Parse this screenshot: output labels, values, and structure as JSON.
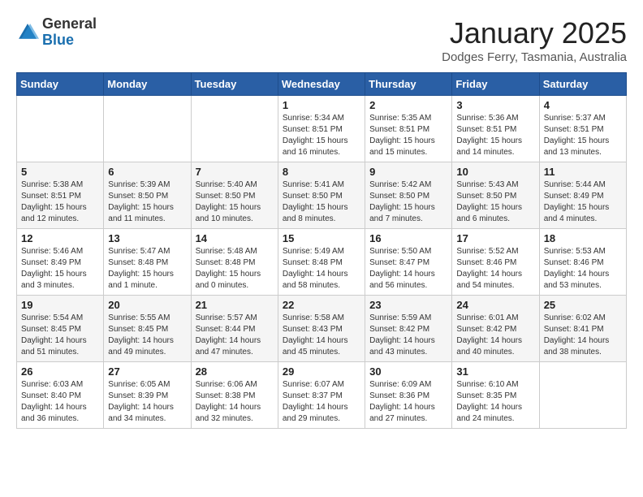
{
  "header": {
    "logo_general": "General",
    "logo_blue": "Blue",
    "month_title": "January 2025",
    "location": "Dodges Ferry, Tasmania, Australia"
  },
  "days_of_week": [
    "Sunday",
    "Monday",
    "Tuesday",
    "Wednesday",
    "Thursday",
    "Friday",
    "Saturday"
  ],
  "weeks": [
    [
      {
        "day": "",
        "info": ""
      },
      {
        "day": "",
        "info": ""
      },
      {
        "day": "",
        "info": ""
      },
      {
        "day": "1",
        "info": "Sunrise: 5:34 AM\nSunset: 8:51 PM\nDaylight: 15 hours\nand 16 minutes."
      },
      {
        "day": "2",
        "info": "Sunrise: 5:35 AM\nSunset: 8:51 PM\nDaylight: 15 hours\nand 15 minutes."
      },
      {
        "day": "3",
        "info": "Sunrise: 5:36 AM\nSunset: 8:51 PM\nDaylight: 15 hours\nand 14 minutes."
      },
      {
        "day": "4",
        "info": "Sunrise: 5:37 AM\nSunset: 8:51 PM\nDaylight: 15 hours\nand 13 minutes."
      }
    ],
    [
      {
        "day": "5",
        "info": "Sunrise: 5:38 AM\nSunset: 8:51 PM\nDaylight: 15 hours\nand 12 minutes."
      },
      {
        "day": "6",
        "info": "Sunrise: 5:39 AM\nSunset: 8:50 PM\nDaylight: 15 hours\nand 11 minutes."
      },
      {
        "day": "7",
        "info": "Sunrise: 5:40 AM\nSunset: 8:50 PM\nDaylight: 15 hours\nand 10 minutes."
      },
      {
        "day": "8",
        "info": "Sunrise: 5:41 AM\nSunset: 8:50 PM\nDaylight: 15 hours\nand 8 minutes."
      },
      {
        "day": "9",
        "info": "Sunrise: 5:42 AM\nSunset: 8:50 PM\nDaylight: 15 hours\nand 7 minutes."
      },
      {
        "day": "10",
        "info": "Sunrise: 5:43 AM\nSunset: 8:50 PM\nDaylight: 15 hours\nand 6 minutes."
      },
      {
        "day": "11",
        "info": "Sunrise: 5:44 AM\nSunset: 8:49 PM\nDaylight: 15 hours\nand 4 minutes."
      }
    ],
    [
      {
        "day": "12",
        "info": "Sunrise: 5:46 AM\nSunset: 8:49 PM\nDaylight: 15 hours\nand 3 minutes."
      },
      {
        "day": "13",
        "info": "Sunrise: 5:47 AM\nSunset: 8:48 PM\nDaylight: 15 hours\nand 1 minute."
      },
      {
        "day": "14",
        "info": "Sunrise: 5:48 AM\nSunset: 8:48 PM\nDaylight: 15 hours\nand 0 minutes."
      },
      {
        "day": "15",
        "info": "Sunrise: 5:49 AM\nSunset: 8:48 PM\nDaylight: 14 hours\nand 58 minutes."
      },
      {
        "day": "16",
        "info": "Sunrise: 5:50 AM\nSunset: 8:47 PM\nDaylight: 14 hours\nand 56 minutes."
      },
      {
        "day": "17",
        "info": "Sunrise: 5:52 AM\nSunset: 8:46 PM\nDaylight: 14 hours\nand 54 minutes."
      },
      {
        "day": "18",
        "info": "Sunrise: 5:53 AM\nSunset: 8:46 PM\nDaylight: 14 hours\nand 53 minutes."
      }
    ],
    [
      {
        "day": "19",
        "info": "Sunrise: 5:54 AM\nSunset: 8:45 PM\nDaylight: 14 hours\nand 51 minutes."
      },
      {
        "day": "20",
        "info": "Sunrise: 5:55 AM\nSunset: 8:45 PM\nDaylight: 14 hours\nand 49 minutes."
      },
      {
        "day": "21",
        "info": "Sunrise: 5:57 AM\nSunset: 8:44 PM\nDaylight: 14 hours\nand 47 minutes."
      },
      {
        "day": "22",
        "info": "Sunrise: 5:58 AM\nSunset: 8:43 PM\nDaylight: 14 hours\nand 45 minutes."
      },
      {
        "day": "23",
        "info": "Sunrise: 5:59 AM\nSunset: 8:42 PM\nDaylight: 14 hours\nand 43 minutes."
      },
      {
        "day": "24",
        "info": "Sunrise: 6:01 AM\nSunset: 8:42 PM\nDaylight: 14 hours\nand 40 minutes."
      },
      {
        "day": "25",
        "info": "Sunrise: 6:02 AM\nSunset: 8:41 PM\nDaylight: 14 hours\nand 38 minutes."
      }
    ],
    [
      {
        "day": "26",
        "info": "Sunrise: 6:03 AM\nSunset: 8:40 PM\nDaylight: 14 hours\nand 36 minutes."
      },
      {
        "day": "27",
        "info": "Sunrise: 6:05 AM\nSunset: 8:39 PM\nDaylight: 14 hours\nand 34 minutes."
      },
      {
        "day": "28",
        "info": "Sunrise: 6:06 AM\nSunset: 8:38 PM\nDaylight: 14 hours\nand 32 minutes."
      },
      {
        "day": "29",
        "info": "Sunrise: 6:07 AM\nSunset: 8:37 PM\nDaylight: 14 hours\nand 29 minutes."
      },
      {
        "day": "30",
        "info": "Sunrise: 6:09 AM\nSunset: 8:36 PM\nDaylight: 14 hours\nand 27 minutes."
      },
      {
        "day": "31",
        "info": "Sunrise: 6:10 AM\nSunset: 8:35 PM\nDaylight: 14 hours\nand 24 minutes."
      },
      {
        "day": "",
        "info": ""
      }
    ]
  ]
}
